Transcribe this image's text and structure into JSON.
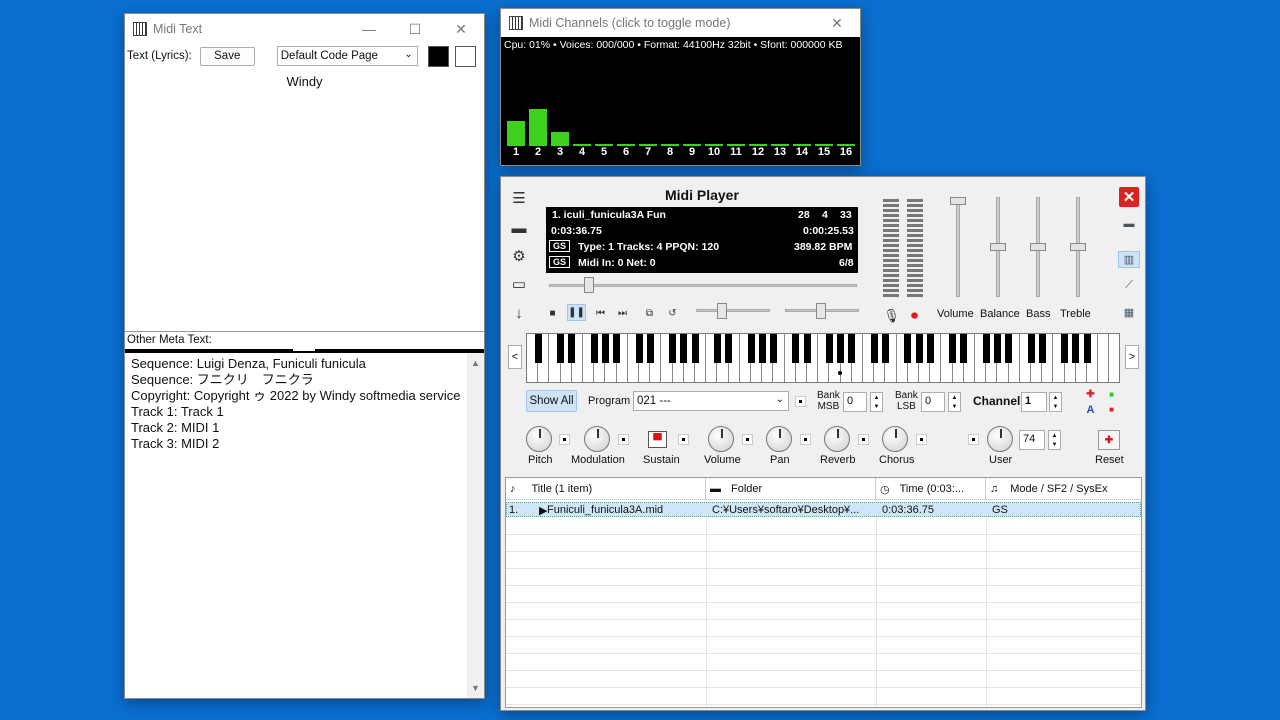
{
  "midi_text": {
    "title": "Midi Text",
    "text_label": "Text (Lyrics):",
    "save_label": "Save",
    "codepage": "Default Code Page",
    "lyrics": "Windy",
    "other_meta_label": "Other Meta Text:",
    "meta_lines": [
      "Sequence: Luigi Denza, Funiculi funicula",
      "Sequence: フニクリ　フニクラ",
      "Copyright: Copyright ゥ 2022 by Windy softmedia service",
      "Track 1: Track 1",
      "Track 2: MIDI 1",
      "Track 3: MIDI 2"
    ]
  },
  "midi_channels": {
    "title": "Midi Channels (click to toggle mode)",
    "status": "Cpu: 01% • Voices: 000/000 • Format: 44100Hz 32bit • Sfont: 000000 KB",
    "channels": [
      "1",
      "2",
      "3",
      "4",
      "5",
      "6",
      "7",
      "8",
      "9",
      "10",
      "11",
      "12",
      "13",
      "14",
      "15",
      "16"
    ],
    "levels": [
      0.28,
      0.41,
      0.16,
      0.02,
      0.02,
      0.02,
      0.02,
      0.02,
      0.02,
      0.02,
      0.02,
      0.02,
      0.02,
      0.02,
      0.02,
      0.02
    ],
    "bar_color": "#3fd11f"
  },
  "player": {
    "title": "Midi Player",
    "lcd": {
      "song": "1. iculi_funicula3A  Fun",
      "bars": "28",
      "beats": "4",
      "ticks": "33",
      "elapsed": "0:03:36.75",
      "remaining": "0:00:25.53",
      "gs1": "GS",
      "info": "Type: 1 Tracks: 4 PPQN: 120",
      "bpm": "389.82 BPM",
      "gs2": "GS",
      "midi_in": "Midi In: 0  Net: 0",
      "time_sig": "6/8"
    },
    "mixer_labels": {
      "volume": "Volume",
      "balance": "Balance",
      "bass": "Bass",
      "treble": "Treble"
    },
    "show_all": "Show All",
    "program_label": "Program",
    "program_value": "021 ---",
    "bank_msb_label": "Bank\nMSB",
    "bank_msb_value": "0",
    "bank_lsb_label": "Bank\nLSB",
    "bank_lsb_value": "0",
    "channel_label": "Channel",
    "channel_value": "1",
    "knobs": [
      "Pitch",
      "Modulation",
      "Sustain",
      "Volume",
      "Pan",
      "Reverb",
      "Chorus",
      "User",
      "Reset"
    ],
    "user_value": "74",
    "playlist": {
      "columns": [
        "Title  (1 item)",
        "Folder",
        "Time (0:03:...",
        "Mode / SF2 / SysEx"
      ],
      "rows": [
        {
          "num": "1.",
          "title": "Funiculi_funicula3A.mid",
          "folder": "C:¥Users¥softaro¥Desktop¥...",
          "time": "0:03:36.75",
          "mode": "GS"
        }
      ]
    }
  }
}
